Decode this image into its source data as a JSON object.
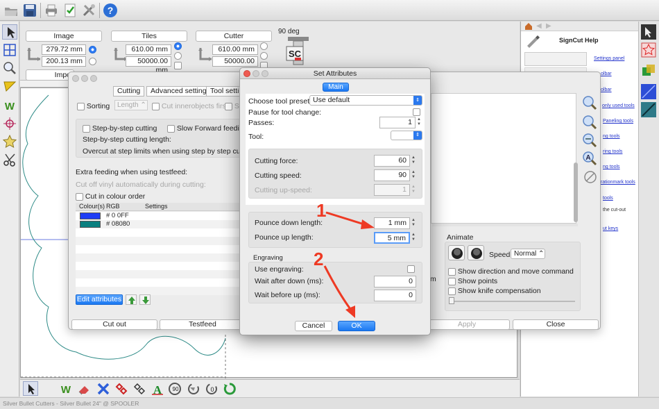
{
  "placement": {
    "image": {
      "title": "Image",
      "width": "279.72 mm",
      "height": "200.13 mm",
      "sub_button": "Impo"
    },
    "tiles": {
      "title": "Tiles",
      "width": "610.00 mm",
      "height": "50000.00 mm"
    },
    "cutter": {
      "title": "Cutter",
      "width": "610.00 mm",
      "height": "50000.00 mm"
    },
    "rotation_label": "90 deg"
  },
  "help": {
    "title": "SignCut Help",
    "links": [
      "Settings panel",
      "olbar",
      "olbar",
      "only used tools",
      "Paneling tools",
      "ng tools",
      "ring tools",
      "ng tools",
      "rationmark tools",
      "tools",
      "the cut-out",
      "ut keys"
    ]
  },
  "bg_dialog": {
    "tabs": [
      "Cutting",
      "Advanced settings",
      "Tool setting"
    ],
    "sorting": "Sorting",
    "length": "Length",
    "cut_inner_first": "Cut innerobjects first",
    "sc": "Sc",
    "step_by_step": "Step-by-step cutting",
    "slow_forward": "Slow Forward feeding w",
    "step_length": "Step-by-step cutting length:",
    "overcut": "Overcut at step limits when using step by step cutting:",
    "extra_feeding": "Extra feeding when using testfeed:",
    "cut_off_vinyl": "Cut off vinyl automatically during cutting:",
    "cut_in_colour_order": "Cut in colour order",
    "col_colours": "Colour(s)",
    "col_rgb": "RGB",
    "col_settings": "Settings",
    "rows": [
      {
        "rgb": "# 0 0FF",
        "swatch": "#1f3df5"
      },
      {
        "rgb": "# 08080",
        "swatch": "#0a7f7f"
      }
    ],
    "edit_attributes": "Edit attributes",
    "cut_out": "Cut out",
    "testfeed": "Testfeed",
    "apply": "Apply",
    "close": "Close",
    "animate": "Animate",
    "speed_label": "Speed:",
    "speed_value": "Normal",
    "show_direction": "Show direction and move command",
    "show_points": "Show points",
    "show_knife": "Show knife compensation",
    "m_char": "m"
  },
  "dialog": {
    "title": "Set Attributes",
    "tab_main": "Main",
    "choose_preset_label": "Choose tool preset:",
    "choose_preset_value": "Use default",
    "pause_label": "Pause for tool change:",
    "passes_label": "Passes:",
    "passes_value": "1",
    "tool_label": "Tool:",
    "cutting_force_label": "Cutting force:",
    "cutting_force_value": "60",
    "cutting_speed_label": "Cutting speed:",
    "cutting_speed_value": "90",
    "cutting_upspeed_label": "Cutting up-speed:",
    "cutting_upspeed_value": "1",
    "pounce_down_label": "Pounce down length:",
    "pounce_down_value": "1 mm",
    "pounce_up_label": "Pounce up length:",
    "pounce_up_value": "5 mm",
    "engraving_header": "Engraving",
    "use_engraving_label": "Use engraving:",
    "wait_after_down_label": "Wait after down (ms):",
    "wait_after_down_value": "0",
    "wait_before_up_label": "Wait before up (ms):",
    "wait_before_up_value": "0",
    "cancel": "Cancel",
    "ok": "OK"
  },
  "annotations": {
    "one": "1",
    "two": "2",
    "color": "#ee3a24"
  },
  "status": "Silver Bullet Cutters - Silver Bullet 24\" @ SPOOLER"
}
